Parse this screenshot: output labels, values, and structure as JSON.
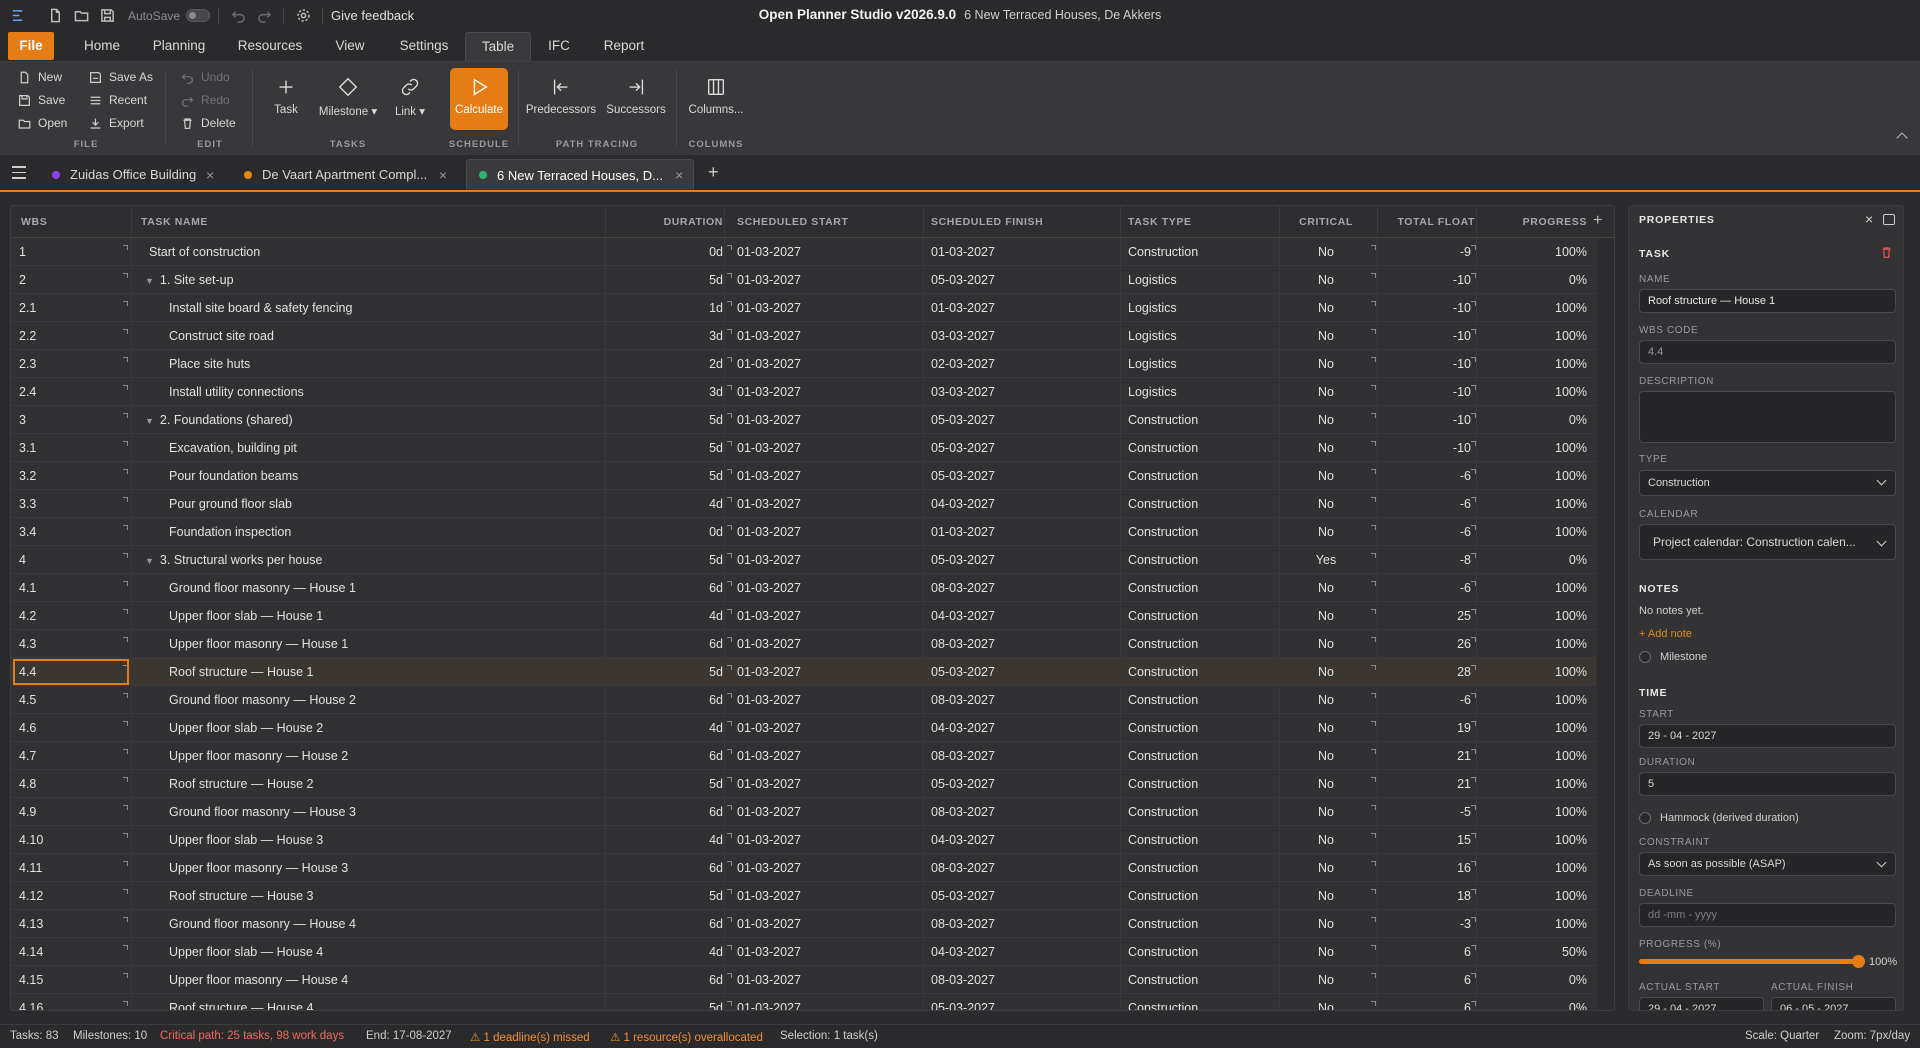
{
  "titlebar": {
    "autosave_label": "AutoSave",
    "feedback_label": "Give feedback",
    "app_title": "Open Planner Studio v2026.9.0",
    "project_subtitle": "6 New Terraced Houses, De Akkers"
  },
  "menu": {
    "tabs": [
      "File",
      "Home",
      "Planning",
      "Resources",
      "View",
      "Settings",
      "Table",
      "IFC",
      "Report"
    ],
    "active": "Table"
  },
  "ribbon": {
    "file": {
      "new": "New",
      "save": "Save",
      "open": "Open",
      "save_as": "Save As",
      "recent": "Recent",
      "export": "Export",
      "group": "FILE"
    },
    "edit": {
      "undo": "Undo",
      "redo": "Redo",
      "delete": "Delete",
      "group": "EDIT"
    },
    "tasks": {
      "task": "Task",
      "milestone": "Milestone ▾",
      "link": "Link ▾",
      "group": "TASKS"
    },
    "schedule": {
      "calculate": "Calculate",
      "group": "SCHEDULE"
    },
    "path": {
      "predecessors": "Predecessors",
      "successors": "Successors",
      "group": "PATH TRACING"
    },
    "columns": {
      "columns": "Columns...",
      "group": "COLUMNS"
    }
  },
  "doc_tabs": [
    {
      "label": "Zuidas Office Building",
      "color": "#8e44e8"
    },
    {
      "label": "De Vaart Apartment Compl...",
      "color": "#e58a14"
    },
    {
      "label": "6 New Terraced Houses, D...",
      "color": "#2fb36a"
    }
  ],
  "table": {
    "headers": [
      "WBS",
      "TASK NAME",
      "DURATION",
      "SCHEDULED START",
      "SCHEDULED FINISH",
      "TASK TYPE",
      "CRITICAL",
      "TOTAL FLOAT",
      "PROGRESS"
    ],
    "rows": [
      {
        "wbs": "1",
        "name": "Start of construction",
        "level": 1,
        "group": false,
        "dur": "0d",
        "start": "01-03-2027",
        "finish": "01-03-2027",
        "type": "Construction",
        "crit": "No",
        "float": "-9",
        "prog": "100%"
      },
      {
        "wbs": "2",
        "name": "1. Site set-up",
        "level": 1,
        "group": true,
        "dur": "5d",
        "start": "01-03-2027",
        "finish": "05-03-2027",
        "type": "Logistics",
        "crit": "No",
        "float": "-10",
        "prog": "0%"
      },
      {
        "wbs": "2.1",
        "name": "Install site board & safety fencing",
        "level": 2,
        "group": false,
        "dur": "1d",
        "start": "01-03-2027",
        "finish": "01-03-2027",
        "type": "Logistics",
        "crit": "No",
        "float": "-10",
        "prog": "100%"
      },
      {
        "wbs": "2.2",
        "name": "Construct site road",
        "level": 2,
        "group": false,
        "dur": "3d",
        "start": "01-03-2027",
        "finish": "03-03-2027",
        "type": "Logistics",
        "crit": "No",
        "float": "-10",
        "prog": "100%"
      },
      {
        "wbs": "2.3",
        "name": "Place site huts",
        "level": 2,
        "group": false,
        "dur": "2d",
        "start": "01-03-2027",
        "finish": "02-03-2027",
        "type": "Logistics",
        "crit": "No",
        "float": "-10",
        "prog": "100%"
      },
      {
        "wbs": "2.4",
        "name": "Install utility connections",
        "level": 2,
        "group": false,
        "dur": "3d",
        "start": "01-03-2027",
        "finish": "03-03-2027",
        "type": "Logistics",
        "crit": "No",
        "float": "-10",
        "prog": "100%"
      },
      {
        "wbs": "3",
        "name": "2. Foundations (shared)",
        "level": 1,
        "group": true,
        "dur": "5d",
        "start": "01-03-2027",
        "finish": "05-03-2027",
        "type": "Construction",
        "crit": "No",
        "float": "-10",
        "prog": "0%"
      },
      {
        "wbs": "3.1",
        "name": "Excavation, building pit",
        "level": 2,
        "group": false,
        "dur": "5d",
        "start": "01-03-2027",
        "finish": "05-03-2027",
        "type": "Construction",
        "crit": "No",
        "float": "-10",
        "prog": "100%"
      },
      {
        "wbs": "3.2",
        "name": "Pour foundation beams",
        "level": 2,
        "group": false,
        "dur": "5d",
        "start": "01-03-2027",
        "finish": "05-03-2027",
        "type": "Construction",
        "crit": "No",
        "float": "-6",
        "prog": "100%"
      },
      {
        "wbs": "3.3",
        "name": "Pour ground floor slab",
        "level": 2,
        "group": false,
        "dur": "4d",
        "start": "01-03-2027",
        "finish": "04-03-2027",
        "type": "Construction",
        "crit": "No",
        "float": "-6",
        "prog": "100%"
      },
      {
        "wbs": "3.4",
        "name": "Foundation inspection",
        "level": 2,
        "group": false,
        "dur": "0d",
        "start": "01-03-2027",
        "finish": "01-03-2027",
        "type": "Construction",
        "crit": "No",
        "float": "-6",
        "prog": "100%"
      },
      {
        "wbs": "4",
        "name": "3. Structural works per house",
        "level": 1,
        "group": true,
        "dur": "5d",
        "start": "01-03-2027",
        "finish": "05-03-2027",
        "type": "Construction",
        "crit": "Yes",
        "float": "-8",
        "prog": "0%"
      },
      {
        "wbs": "4.1",
        "name": "Ground floor masonry — House 1",
        "level": 2,
        "group": false,
        "dur": "6d",
        "start": "01-03-2027",
        "finish": "08-03-2027",
        "type": "Construction",
        "crit": "No",
        "float": "-6",
        "prog": "100%"
      },
      {
        "wbs": "4.2",
        "name": "Upper floor slab — House 1",
        "level": 2,
        "group": false,
        "dur": "4d",
        "start": "01-03-2027",
        "finish": "04-03-2027",
        "type": "Construction",
        "crit": "No",
        "float": "25",
        "prog": "100%"
      },
      {
        "wbs": "4.3",
        "name": "Upper floor masonry — House 1",
        "level": 2,
        "group": false,
        "dur": "6d",
        "start": "01-03-2027",
        "finish": "08-03-2027",
        "type": "Construction",
        "crit": "No",
        "float": "26",
        "prog": "100%"
      },
      {
        "wbs": "4.4",
        "name": "Roof structure — House 1",
        "level": 2,
        "group": false,
        "dur": "5d",
        "start": "01-03-2027",
        "finish": "05-03-2027",
        "type": "Construction",
        "crit": "No",
        "float": "28",
        "prog": "100%",
        "selected": true
      },
      {
        "wbs": "4.5",
        "name": "Ground floor masonry — House 2",
        "level": 2,
        "group": false,
        "dur": "6d",
        "start": "01-03-2027",
        "finish": "08-03-2027",
        "type": "Construction",
        "crit": "No",
        "float": "-6",
        "prog": "100%"
      },
      {
        "wbs": "4.6",
        "name": "Upper floor slab — House 2",
        "level": 2,
        "group": false,
        "dur": "4d",
        "start": "01-03-2027",
        "finish": "04-03-2027",
        "type": "Construction",
        "crit": "No",
        "float": "19",
        "prog": "100%"
      },
      {
        "wbs": "4.7",
        "name": "Upper floor masonry — House 2",
        "level": 2,
        "group": false,
        "dur": "6d",
        "start": "01-03-2027",
        "finish": "08-03-2027",
        "type": "Construction",
        "crit": "No",
        "float": "21",
        "prog": "100%"
      },
      {
        "wbs": "4.8",
        "name": "Roof structure — House 2",
        "level": 2,
        "group": false,
        "dur": "5d",
        "start": "01-03-2027",
        "finish": "05-03-2027",
        "type": "Construction",
        "crit": "No",
        "float": "21",
        "prog": "100%"
      },
      {
        "wbs": "4.9",
        "name": "Ground floor masonry — House 3",
        "level": 2,
        "group": false,
        "dur": "6d",
        "start": "01-03-2027",
        "finish": "08-03-2027",
        "type": "Construction",
        "crit": "No",
        "float": "-5",
        "prog": "100%"
      },
      {
        "wbs": "4.10",
        "name": "Upper floor slab — House 3",
        "level": 2,
        "group": false,
        "dur": "4d",
        "start": "01-03-2027",
        "finish": "04-03-2027",
        "type": "Construction",
        "crit": "No",
        "float": "15",
        "prog": "100%"
      },
      {
        "wbs": "4.11",
        "name": "Upper floor masonry — House 3",
        "level": 2,
        "group": false,
        "dur": "6d",
        "start": "01-03-2027",
        "finish": "08-03-2027",
        "type": "Construction",
        "crit": "No",
        "float": "16",
        "prog": "100%"
      },
      {
        "wbs": "4.12",
        "name": "Roof structure — House 3",
        "level": 2,
        "group": false,
        "dur": "5d",
        "start": "01-03-2027",
        "finish": "05-03-2027",
        "type": "Construction",
        "crit": "No",
        "float": "18",
        "prog": "100%"
      },
      {
        "wbs": "4.13",
        "name": "Ground floor masonry — House 4",
        "level": 2,
        "group": false,
        "dur": "6d",
        "start": "01-03-2027",
        "finish": "08-03-2027",
        "type": "Construction",
        "crit": "No",
        "float": "-3",
        "prog": "100%"
      },
      {
        "wbs": "4.14",
        "name": "Upper floor slab — House 4",
        "level": 2,
        "group": false,
        "dur": "4d",
        "start": "01-03-2027",
        "finish": "04-03-2027",
        "type": "Construction",
        "crit": "No",
        "float": "6",
        "prog": "50%"
      },
      {
        "wbs": "4.15",
        "name": "Upper floor masonry — House 4",
        "level": 2,
        "group": false,
        "dur": "6d",
        "start": "01-03-2027",
        "finish": "08-03-2027",
        "type": "Construction",
        "crit": "No",
        "float": "6",
        "prog": "0%"
      },
      {
        "wbs": "4.16",
        "name": "Roof structure — House 4",
        "level": 2,
        "group": false,
        "dur": "5d",
        "start": "01-03-2027",
        "finish": "05-03-2027",
        "type": "Construction",
        "crit": "No",
        "float": "6",
        "prog": "0%"
      }
    ]
  },
  "properties": {
    "title": "PROPERTIES",
    "section_task": "TASK",
    "name_label": "NAME",
    "name_value": "Roof structure — House 1",
    "wbs_label": "WBS CODE",
    "wbs_value": "4.4",
    "desc_label": "DESCRIPTION",
    "type_label": "TYPE",
    "type_value": "Construction",
    "calendar_label": "CALENDAR",
    "calendar_value": "Project calendar: Construction calen...",
    "section_notes": "NOTES",
    "notes_empty": "No notes yet.",
    "add_note": "+ Add note",
    "milestone_label": "Milestone",
    "section_time": "TIME",
    "start_label": "START",
    "start_value": "29 - 04 - 2027",
    "duration_label": "DURATION",
    "duration_value": "5",
    "hammock_label": "Hammock (derived duration)",
    "constraint_label": "CONSTRAINT",
    "constraint_value": "As soon as possible (ASAP)",
    "deadline_label": "DEADLINE",
    "deadline_placeholder": "dd -mm - yyyy",
    "progress_label": "PROGRESS (%)",
    "progress_value": 100,
    "progress_text": "100%",
    "actual_start_label": "ACTUAL START",
    "actual_start_value": "29 - 04 - 2027",
    "actual_finish_label": "ACTUAL FINISH",
    "actual_finish_value": "06 - 05 - 2027"
  },
  "status": {
    "tasks": "Tasks: 83",
    "milestones": "Milestones: 10",
    "critical": "Critical path: 25 tasks, 98 work days",
    "end": "End: 17-08-2027",
    "deadline": "⚠ 1 deadline(s) missed",
    "overalloc": "⚠ 1 resource(s) overallocated",
    "selection": "Selection: 1 task(s)",
    "scale": "Scale: Quarter",
    "zoom": "Zoom: 7px/day"
  },
  "colors": {
    "accent": "#e57c14",
    "critical_text": "#f06b5a",
    "warning_text": "#f0903a"
  }
}
